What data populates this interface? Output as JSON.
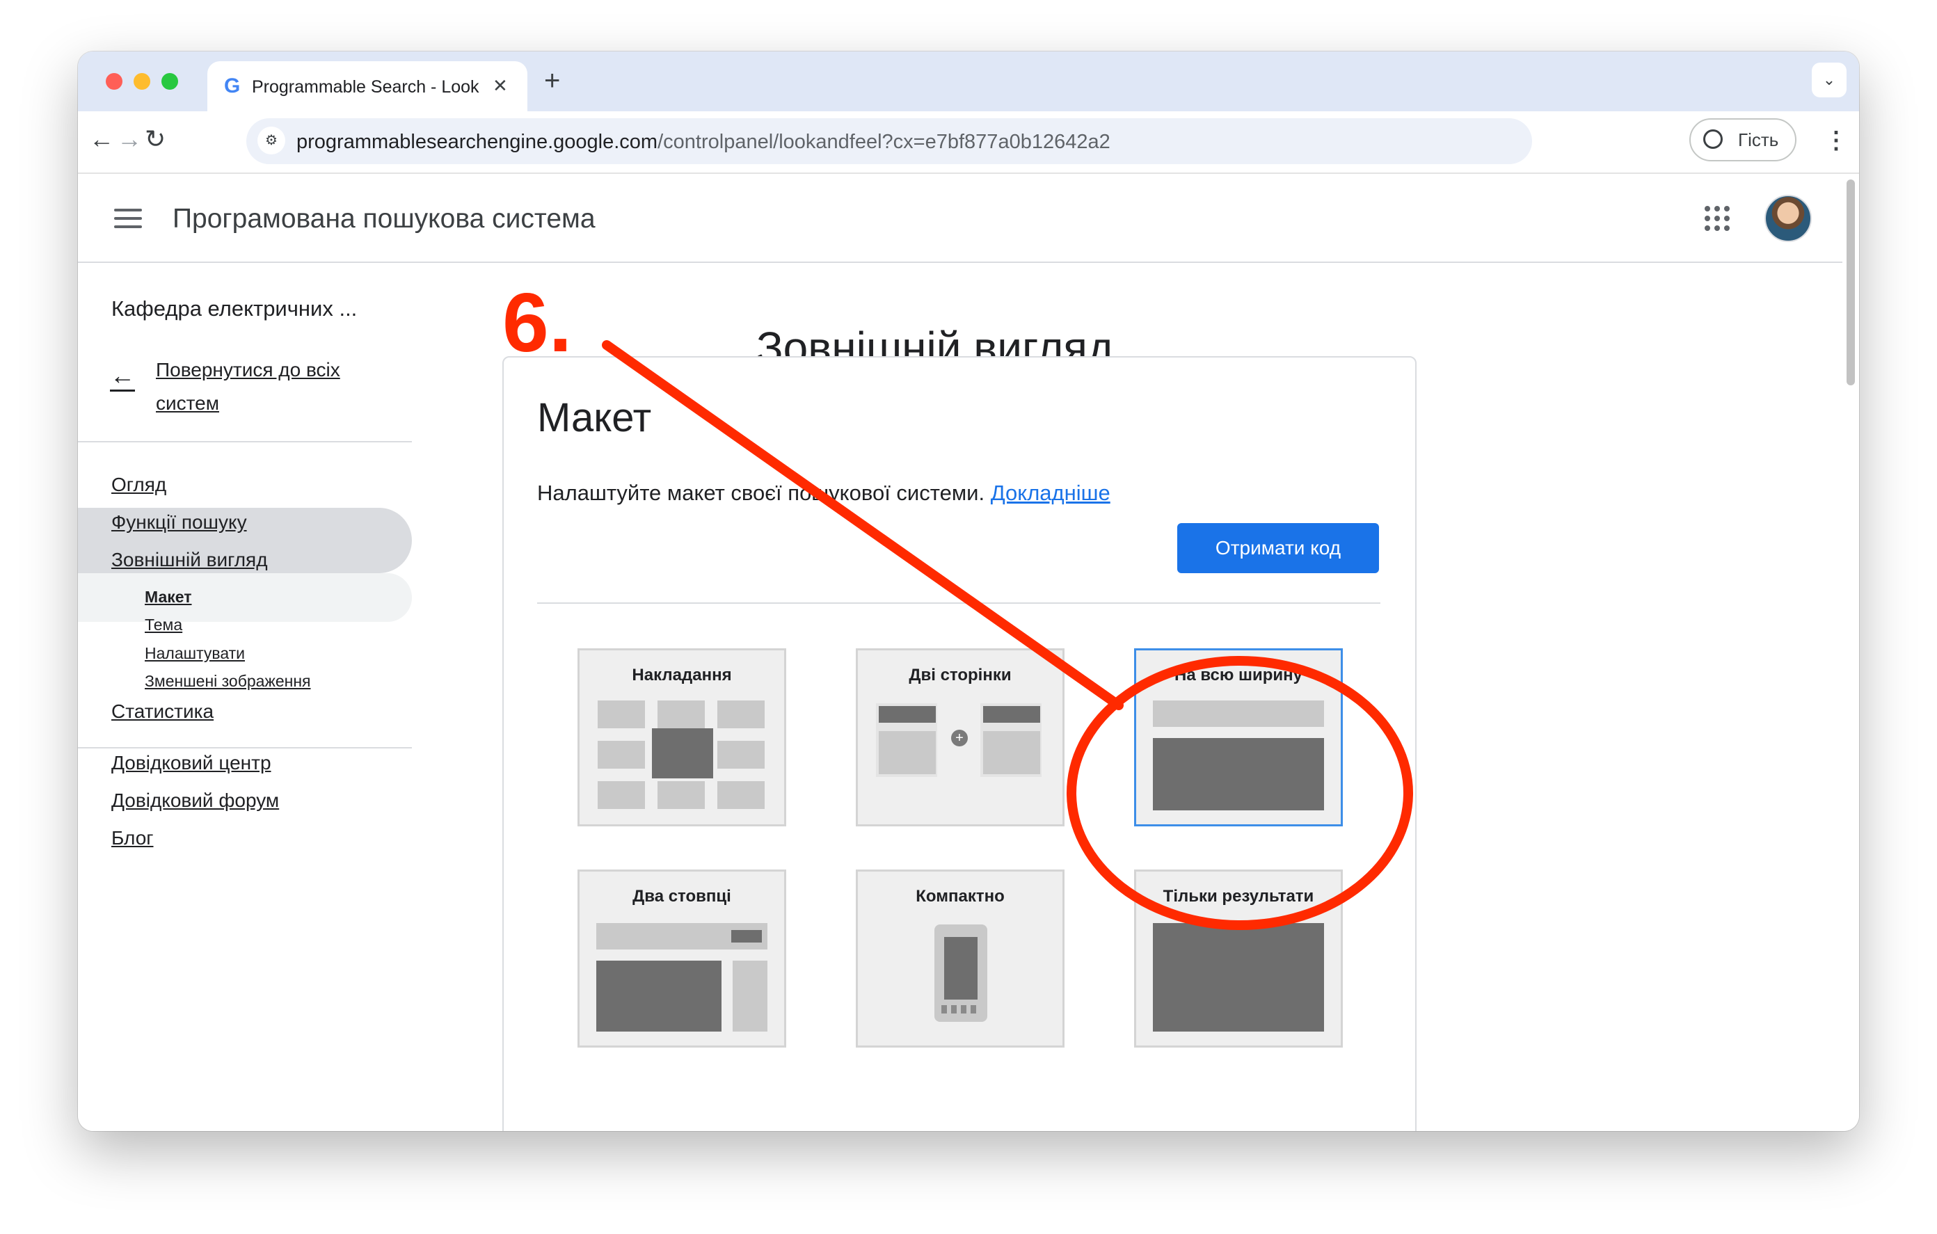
{
  "browser": {
    "tab_icon": "G",
    "tab_title": "Programmable Search - Look",
    "tab_close": "✕",
    "new_tab": "+",
    "tab_menu": "⌄",
    "url_host": "programmablesearchengine.google.com",
    "url_path": "/controlpanel/lookandfeel?cx=e7bf877a0b12642a2",
    "guest_label": "Гість",
    "menu_icon": "⋮",
    "back_icon": "←",
    "forward_icon": "→",
    "reload_icon": "↻",
    "site_info_icon": "⚙"
  },
  "app": {
    "title": "Програмована пошукова система"
  },
  "sidebar": {
    "project": "Кафедра електричних ...",
    "back_icon": "←",
    "back_label": "Повернутися до всіх систем",
    "items": [
      {
        "label": "Огляд"
      },
      {
        "label": "Функції пошуку"
      },
      {
        "label": "Зовнішній вигляд"
      },
      {
        "label": "Статистика"
      }
    ],
    "subitems": [
      {
        "label": "Макет"
      },
      {
        "label": "Тема"
      },
      {
        "label": "Налаштувати"
      },
      {
        "label": "Зменшені зображення"
      }
    ],
    "help": [
      {
        "label": "Довідковий центр"
      },
      {
        "label": "Довідковий форум"
      },
      {
        "label": "Блог"
      }
    ]
  },
  "main": {
    "heading": "Зовнішній вигляд",
    "card_title": "Макет",
    "card_desc": "Налаштуйте макет своєї пошукової системи.",
    "learn_more": "Докладніше",
    "get_code_button": "Отримати код",
    "layouts": [
      {
        "label": "Накладання"
      },
      {
        "label": "Дві сторінки"
      },
      {
        "label": "На всю ширину"
      },
      {
        "label": "Два стовпці"
      },
      {
        "label": "Компактно"
      },
      {
        "label": "Тільки результати"
      }
    ],
    "selected_layout": "На всю ширину"
  },
  "annotation": {
    "step_label": "6.",
    "color": "#ff2a00"
  }
}
